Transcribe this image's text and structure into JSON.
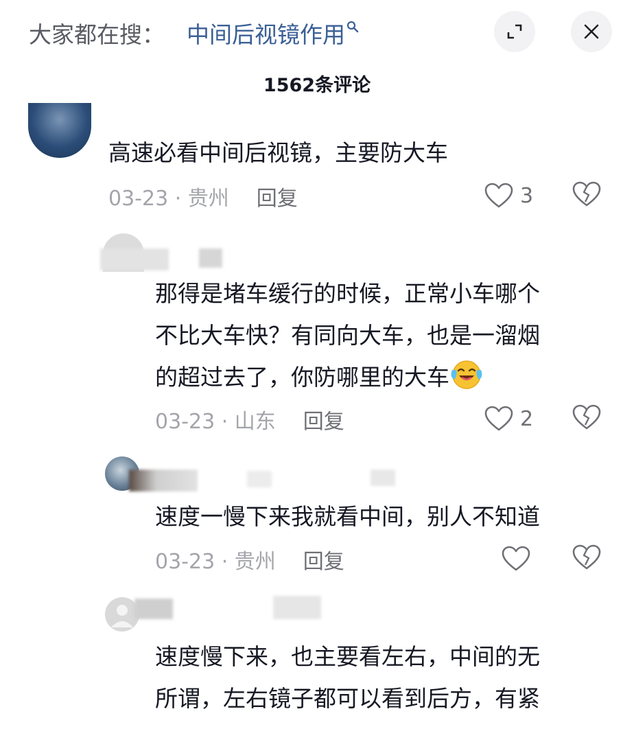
{
  "header": {
    "search_prefix": "大家都在搜：",
    "search_term": "中间后视镜作用"
  },
  "comment_count_title": "1562条评论",
  "comments": [
    {
      "text": "高速必看中间后视镜，主要防大车",
      "date": "03-23",
      "location": "贵州",
      "reply_label": "回复",
      "likes": "3"
    },
    {
      "text_lines": [
        "那得是堵车缓行的时候，正常小车哪个",
        "不比大车快？有同向大车，也是一溜烟",
        "的超过去了，你防哪里的大车"
      ],
      "emoji": "crying-laughing-emoji",
      "date": "03-23",
      "location": "山东",
      "reply_label": "回复",
      "likes": "2"
    },
    {
      "text": "速度一慢下来我就看中间，别人不知道",
      "date": "03-23",
      "location": "贵州",
      "reply_label": "回复",
      "likes": ""
    },
    {
      "text_lines": [
        "速度慢下来，也主要看左右，中间的无",
        "所谓，左右镜子都可以看到后方，有紧"
      ]
    }
  ],
  "separator": " · ",
  "colors": {
    "link": "#3a5f95",
    "text": "#161823",
    "meta": "#a4a5aa",
    "icon": "#6f7075"
  }
}
